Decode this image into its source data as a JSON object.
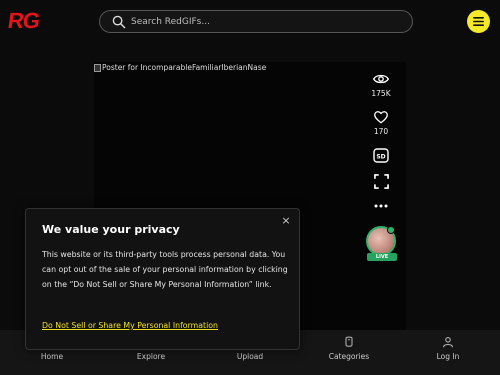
{
  "header": {
    "logo": "RG",
    "search_placeholder": "Search RedGIFs...",
    "search_icon": "search-icon",
    "menu_icon": "hamburger-menu-icon"
  },
  "video": {
    "poster_alt": "Poster for IncomparableFamiliarIberianNase"
  },
  "actions": {
    "views": "175K",
    "likes": "170",
    "quality": "SD",
    "live_label": "LIVE"
  },
  "bottom_nav": {
    "items": [
      {
        "label": "Home",
        "icon": "home-icon"
      },
      {
        "label": "Explore",
        "icon": "explore-icon"
      },
      {
        "label": "Upload",
        "icon": "upload-icon"
      },
      {
        "label": "Categories",
        "icon": "categories-icon"
      },
      {
        "label": "Log In",
        "icon": "user-icon"
      }
    ]
  },
  "privacy": {
    "title": "We value your privacy",
    "body": "This website or its third-party tools process personal data. You can opt out of the sale of your personal information by clicking on the “Do Not Sell or Share My Personal Information” link.",
    "link": "Do Not Sell or Share My Personal Information",
    "close": "×"
  },
  "colors": {
    "brand_red": "#e0151b",
    "accent_yellow": "#f4ea2a",
    "live_green": "#2fb36b",
    "background": "#0b0b0b"
  }
}
